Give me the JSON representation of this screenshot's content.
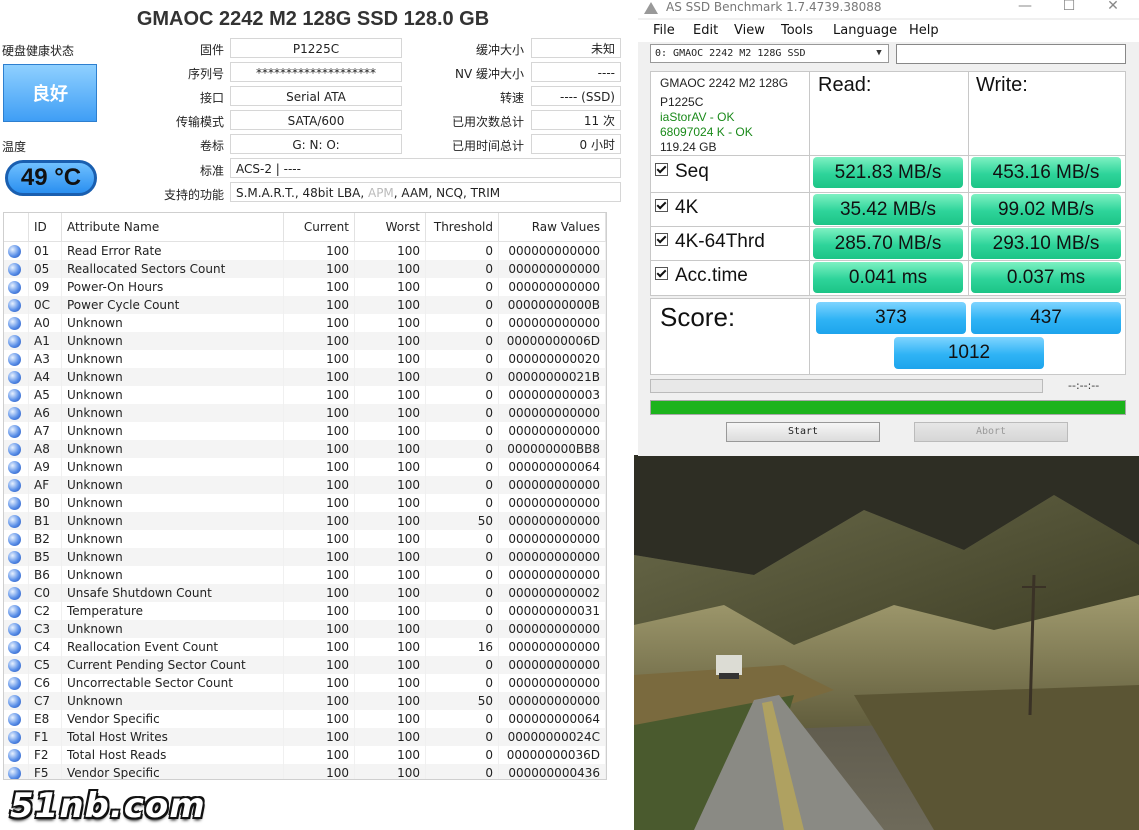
{
  "cdi": {
    "title": "GMAOC 2242 M2 128G  SSD  128.0 GB",
    "health_label": "硬盘健康状态",
    "health_value": "良好",
    "temp_label": "温度",
    "temp_value": "49 °C",
    "fields_left": [
      {
        "label": "固件",
        "value": "P1225C"
      },
      {
        "label": "序列号",
        "value": "********************"
      },
      {
        "label": "接口",
        "value": "Serial ATA"
      },
      {
        "label": "传输模式",
        "value": "SATA/600"
      },
      {
        "label": "卷标",
        "value": "G: N: O:"
      }
    ],
    "fields_right": [
      {
        "label": "缓冲大小",
        "value": "未知"
      },
      {
        "label": "NV 缓冲大小",
        "value": "----"
      },
      {
        "label": "转速",
        "value": "---- (SSD)"
      },
      {
        "label": "已用次数总计",
        "value": "11 次"
      },
      {
        "label": "已用时间总计",
        "value": "0 小时"
      }
    ],
    "standard_label": "标准",
    "standard_value": "ACS-2 | ----",
    "features_label": "支持的功能",
    "features_pre": "S.M.A.R.T., 48bit LBA, ",
    "features_apm": "APM",
    "features_post": ", AAM, NCQ, TRIM",
    "smart_headers": [
      "ID",
      "Attribute Name",
      "Current",
      "Worst",
      "Threshold",
      "Raw Values"
    ],
    "smart_rows": [
      [
        "01",
        "Read Error Rate",
        "100",
        "100",
        "0",
        "000000000000"
      ],
      [
        "05",
        "Reallocated Sectors Count",
        "100",
        "100",
        "0",
        "000000000000"
      ],
      [
        "09",
        "Power-On Hours",
        "100",
        "100",
        "0",
        "000000000000"
      ],
      [
        "0C",
        "Power Cycle Count",
        "100",
        "100",
        "0",
        "00000000000B"
      ],
      [
        "A0",
        "Unknown",
        "100",
        "100",
        "0",
        "000000000000"
      ],
      [
        "A1",
        "Unknown",
        "100",
        "100",
        "0",
        "00000000006D"
      ],
      [
        "A3",
        "Unknown",
        "100",
        "100",
        "0",
        "000000000020"
      ],
      [
        "A4",
        "Unknown",
        "100",
        "100",
        "0",
        "00000000021B"
      ],
      [
        "A5",
        "Unknown",
        "100",
        "100",
        "0",
        "000000000003"
      ],
      [
        "A6",
        "Unknown",
        "100",
        "100",
        "0",
        "000000000000"
      ],
      [
        "A7",
        "Unknown",
        "100",
        "100",
        "0",
        "000000000000"
      ],
      [
        "A8",
        "Unknown",
        "100",
        "100",
        "0",
        "000000000BB8"
      ],
      [
        "A9",
        "Unknown",
        "100",
        "100",
        "0",
        "000000000064"
      ],
      [
        "AF",
        "Unknown",
        "100",
        "100",
        "0",
        "000000000000"
      ],
      [
        "B0",
        "Unknown",
        "100",
        "100",
        "0",
        "000000000000"
      ],
      [
        "B1",
        "Unknown",
        "100",
        "100",
        "50",
        "000000000000"
      ],
      [
        "B2",
        "Unknown",
        "100",
        "100",
        "0",
        "000000000000"
      ],
      [
        "B5",
        "Unknown",
        "100",
        "100",
        "0",
        "000000000000"
      ],
      [
        "B6",
        "Unknown",
        "100",
        "100",
        "0",
        "000000000000"
      ],
      [
        "C0",
        "Unsafe Shutdown Count",
        "100",
        "100",
        "0",
        "000000000002"
      ],
      [
        "C2",
        "Temperature",
        "100",
        "100",
        "0",
        "000000000031"
      ],
      [
        "C3",
        "Unknown",
        "100",
        "100",
        "0",
        "000000000000"
      ],
      [
        "C4",
        "Reallocation Event Count",
        "100",
        "100",
        "16",
        "000000000000"
      ],
      [
        "C5",
        "Current Pending Sector Count",
        "100",
        "100",
        "0",
        "000000000000"
      ],
      [
        "C6",
        "Uncorrectable Sector Count",
        "100",
        "100",
        "0",
        "000000000000"
      ],
      [
        "C7",
        "Unknown",
        "100",
        "100",
        "50",
        "000000000000"
      ],
      [
        "E8",
        "Vendor Specific",
        "100",
        "100",
        "0",
        "000000000064"
      ],
      [
        "F1",
        "Total Host Writes",
        "100",
        "100",
        "0",
        "00000000024C"
      ],
      [
        "F2",
        "Total Host Reads",
        "100",
        "100",
        "0",
        "00000000036D"
      ],
      [
        "F5",
        "Vendor Specific",
        "100",
        "100",
        "0",
        "000000000436"
      ]
    ]
  },
  "watermark": "51nb.com",
  "asssd": {
    "title": "AS SSD Benchmark 1.7.4739.38088",
    "menu": [
      "File",
      "Edit",
      "View",
      "Tools",
      "Language",
      "Help"
    ],
    "drive_select": "0: GMAOC 2242 M2 128G  SSD",
    "info": {
      "model": "GMAOC 2242 M2 128G",
      "firmware": "P1225C",
      "driver": "iaStorAV - OK",
      "alignment": "68097024 K - OK",
      "size": "119.24 GB"
    },
    "read_header": "Read:",
    "write_header": "Write:",
    "rows": [
      {
        "label": "Seq",
        "read": "521.83 MB/s",
        "write": "453.16 MB/s"
      },
      {
        "label": "4K",
        "read": "35.42 MB/s",
        "write": "99.02 MB/s"
      },
      {
        "label": "4K-64Thrd",
        "read": "285.70 MB/s",
        "write": "293.10 MB/s"
      },
      {
        "label": "Acc.time",
        "read": "0.041 ms",
        "write": "0.037 ms"
      }
    ],
    "score_label": "Score:",
    "score_read": "373",
    "score_write": "437",
    "score_total": "1012",
    "time_display": "--:--:--",
    "progress": 1.0,
    "start_label": "Start",
    "abort_label": "Abort",
    "progress_color": "#1cb31c",
    "accent_green": "#2ed49a",
    "accent_blue": "#2fb3f5"
  }
}
